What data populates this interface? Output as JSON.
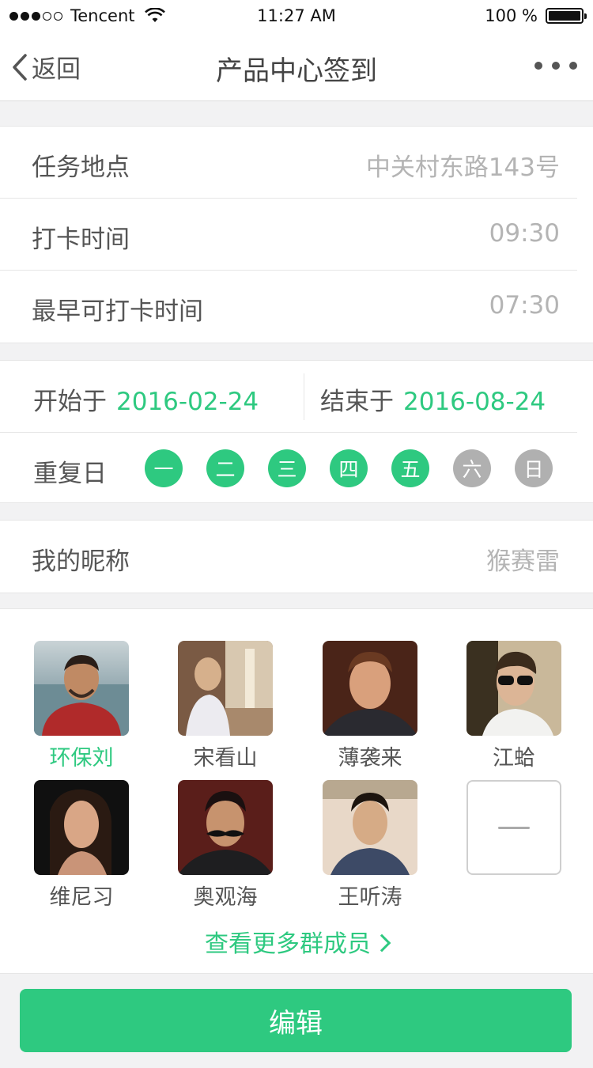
{
  "status_bar": {
    "carrier": "Tencent",
    "time": "11:27 AM",
    "battery": "100 %"
  },
  "nav": {
    "back_label": "返回",
    "title": "产品中心签到"
  },
  "task": {
    "location_label": "任务地点",
    "location_value": "中关村东路143号",
    "checkin_label": "打卡时间",
    "checkin_value": "09:30",
    "earliest_label": "最早可打卡时间",
    "earliest_value": "07:30"
  },
  "schedule": {
    "start_label": "开始于",
    "start_value": "2016-02-24",
    "end_label": "结束于",
    "end_value": "2016-08-24",
    "repeat_label": "重复日",
    "days": [
      {
        "label": "一",
        "active": true
      },
      {
        "label": "二",
        "active": true
      },
      {
        "label": "三",
        "active": true
      },
      {
        "label": "四",
        "active": true
      },
      {
        "label": "五",
        "active": true
      },
      {
        "label": "六",
        "active": false
      },
      {
        "label": "日",
        "active": false
      }
    ]
  },
  "nickname": {
    "label": "我的昵称",
    "value": "猴赛雷"
  },
  "members": [
    {
      "name": "环保刘",
      "highlight": true
    },
    {
      "name": "宋看山",
      "highlight": false
    },
    {
      "name": "薄袭来",
      "highlight": false
    },
    {
      "name": "江蛤",
      "highlight": false
    },
    {
      "name": "维尼习",
      "highlight": false
    },
    {
      "name": "奥观海",
      "highlight": false
    },
    {
      "name": "王听涛",
      "highlight": false
    }
  ],
  "more_members_label": "查看更多群成员",
  "edit_button_label": "编辑",
  "colors": {
    "accent": "#2ec980",
    "inactive_day": "#b0b0b0"
  }
}
